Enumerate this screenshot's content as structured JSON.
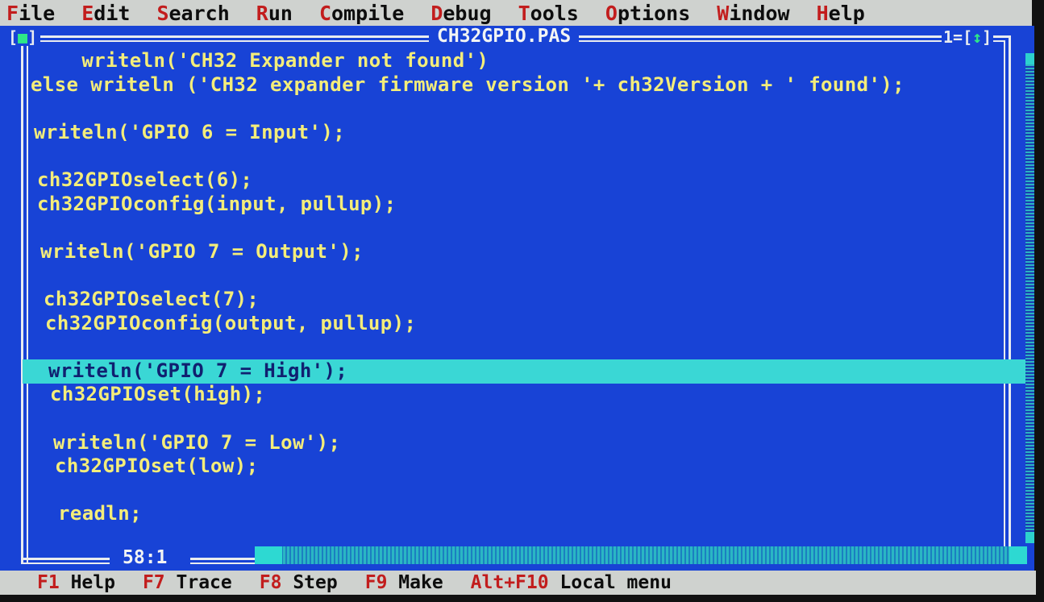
{
  "menu": {
    "items": [
      {
        "hotkey": "F",
        "rest": "ile"
      },
      {
        "hotkey": "E",
        "rest": "dit"
      },
      {
        "hotkey": "S",
        "rest": "earch"
      },
      {
        "hotkey": "R",
        "rest": "un"
      },
      {
        "hotkey": "C",
        "rest": "ompile"
      },
      {
        "hotkey": "D",
        "rest": "ebug"
      },
      {
        "hotkey": "T",
        "rest": "ools"
      },
      {
        "hotkey": "O",
        "rest": "ptions"
      },
      {
        "hotkey": "W",
        "rest": "indow"
      },
      {
        "hotkey": "H",
        "rest": "elp"
      }
    ]
  },
  "window": {
    "close_left": "[",
    "close_mark": "■",
    "close_right": "]",
    "title": "CH32GPIO.PAS",
    "number_prefix": "1=[",
    "zoom_mark": "↕",
    "number_suffix": "]"
  },
  "code": {
    "lines": [
      "    writeln('CH32 Expander not found')",
      "else writeln ('CH32 expander firmware version '+ ch32Version + ' found');",
      "",
      "writeln('GPIO 6 = Input');",
      "",
      "ch32GPIOselect(6);",
      "ch32GPIOconfig(input, pullup);",
      "",
      "writeln('GPIO 7 = Output');",
      "",
      "ch32GPIOselect(7);",
      "ch32GPIOconfig(output, pullup);",
      "",
      "writeln('GPIO 7 = High');",
      "ch32GPIOset(high);",
      "",
      "writeln('GPIO 7 = Low');",
      "ch32GPIOset(low);",
      "",
      "readln;"
    ],
    "current_line_index": 13
  },
  "status": {
    "cursor_position": "58:1"
  },
  "function_keys": [
    {
      "key": "F1",
      "label": "Help"
    },
    {
      "key": "F7",
      "label": "Trace"
    },
    {
      "key": "F8",
      "label": "Step"
    },
    {
      "key": "F9",
      "label": "Make"
    },
    {
      "key": "Alt+F10",
      "label": "Local menu"
    }
  ],
  "colors": {
    "editor_background": "#1843d6",
    "code_text": "#f4ed7a",
    "current_line": "#3ad7d5",
    "menu_background": "#cfd2cf",
    "hotkey": "#c21d1d"
  }
}
